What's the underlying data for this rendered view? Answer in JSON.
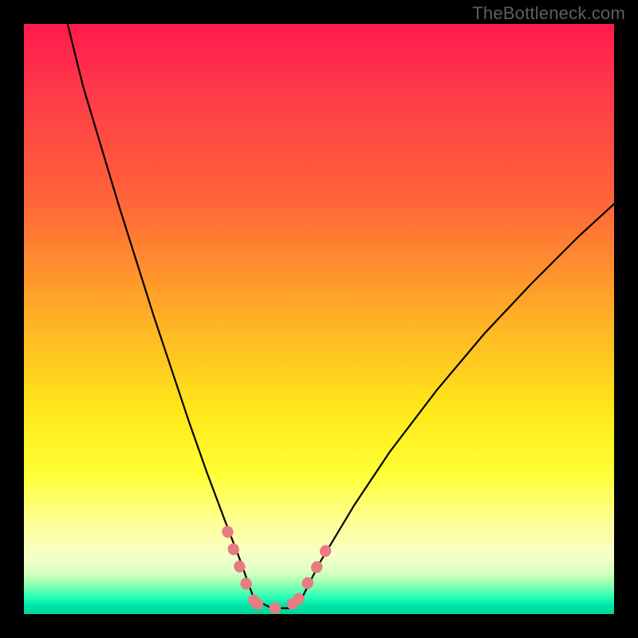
{
  "watermark": "TheBottleneck.com",
  "chart_data": {
    "type": "line",
    "title": "",
    "xlabel": "",
    "ylabel": "",
    "x_range_fraction": [
      0,
      1
    ],
    "y_range_fraction": [
      0,
      1
    ],
    "note": "x and y are fractions of the plot area (0=left/top, 1=right/bottom). The curve represents a bottleneck/mismatch metric that drops to ~0 around x≈0.39–0.47 then rises again.",
    "series": [
      {
        "name": "bottleneck-curve",
        "x": [
          0.074,
          0.1,
          0.13,
          0.16,
          0.19,
          0.22,
          0.25,
          0.28,
          0.31,
          0.34,
          0.365,
          0.39,
          0.42,
          0.45,
          0.47,
          0.5,
          0.56,
          0.62,
          0.7,
          0.78,
          0.86,
          0.94,
          1.0
        ],
        "y": [
          0.0,
          0.105,
          0.205,
          0.305,
          0.4,
          0.495,
          0.585,
          0.675,
          0.76,
          0.84,
          0.905,
          0.975,
          0.99,
          0.99,
          0.975,
          0.915,
          0.815,
          0.725,
          0.62,
          0.525,
          0.44,
          0.36,
          0.305
        ]
      }
    ],
    "highlight_segments": [
      {
        "name": "left-pink-segment",
        "x": [
          0.345,
          0.36,
          0.375,
          0.39
        ],
        "y": [
          0.86,
          0.905,
          0.945,
          0.978
        ]
      },
      {
        "name": "bottom-pink-segment",
        "x": [
          0.395,
          0.415,
          0.435,
          0.455
        ],
        "y": [
          0.983,
          0.99,
          0.99,
          0.983
        ]
      },
      {
        "name": "right-pink-segment",
        "x": [
          0.465,
          0.485,
          0.505,
          0.52
        ],
        "y": [
          0.975,
          0.94,
          0.905,
          0.875
        ]
      }
    ],
    "colors": {
      "curve": "#000000",
      "highlight": "#e77b81",
      "gradient_top": "#ff1a4b",
      "gradient_bottom": "#00d49a"
    }
  }
}
